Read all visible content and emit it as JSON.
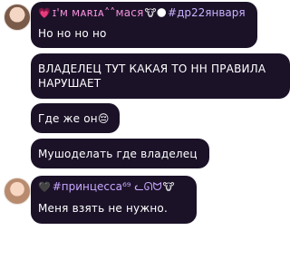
{
  "messages": [
    {
      "user": {
        "heart": "💗",
        "name": "ɪ'ᴍ ᴍᴀʀɪᴀ˄˄мася",
        "emoji": "🐮🌑",
        "tag": "#др22января"
      },
      "text": "Но но но но"
    },
    {
      "text": "ВЛАДЕЛЕЦ ТУТ КАКАЯ ТО НН ПРАВИЛА НАРУШАЕТ"
    },
    {
      "text": "Где же он",
      "emoji": "😔"
    },
    {
      "text": "Мушоделать где владелец"
    },
    {
      "user": {
        "heart": "🖤",
        "name": "#принцесса⁶⁹ ᓚᘏᗢ",
        "emoji": "🐮"
      },
      "text": "Меня взять не нужно."
    }
  ]
}
